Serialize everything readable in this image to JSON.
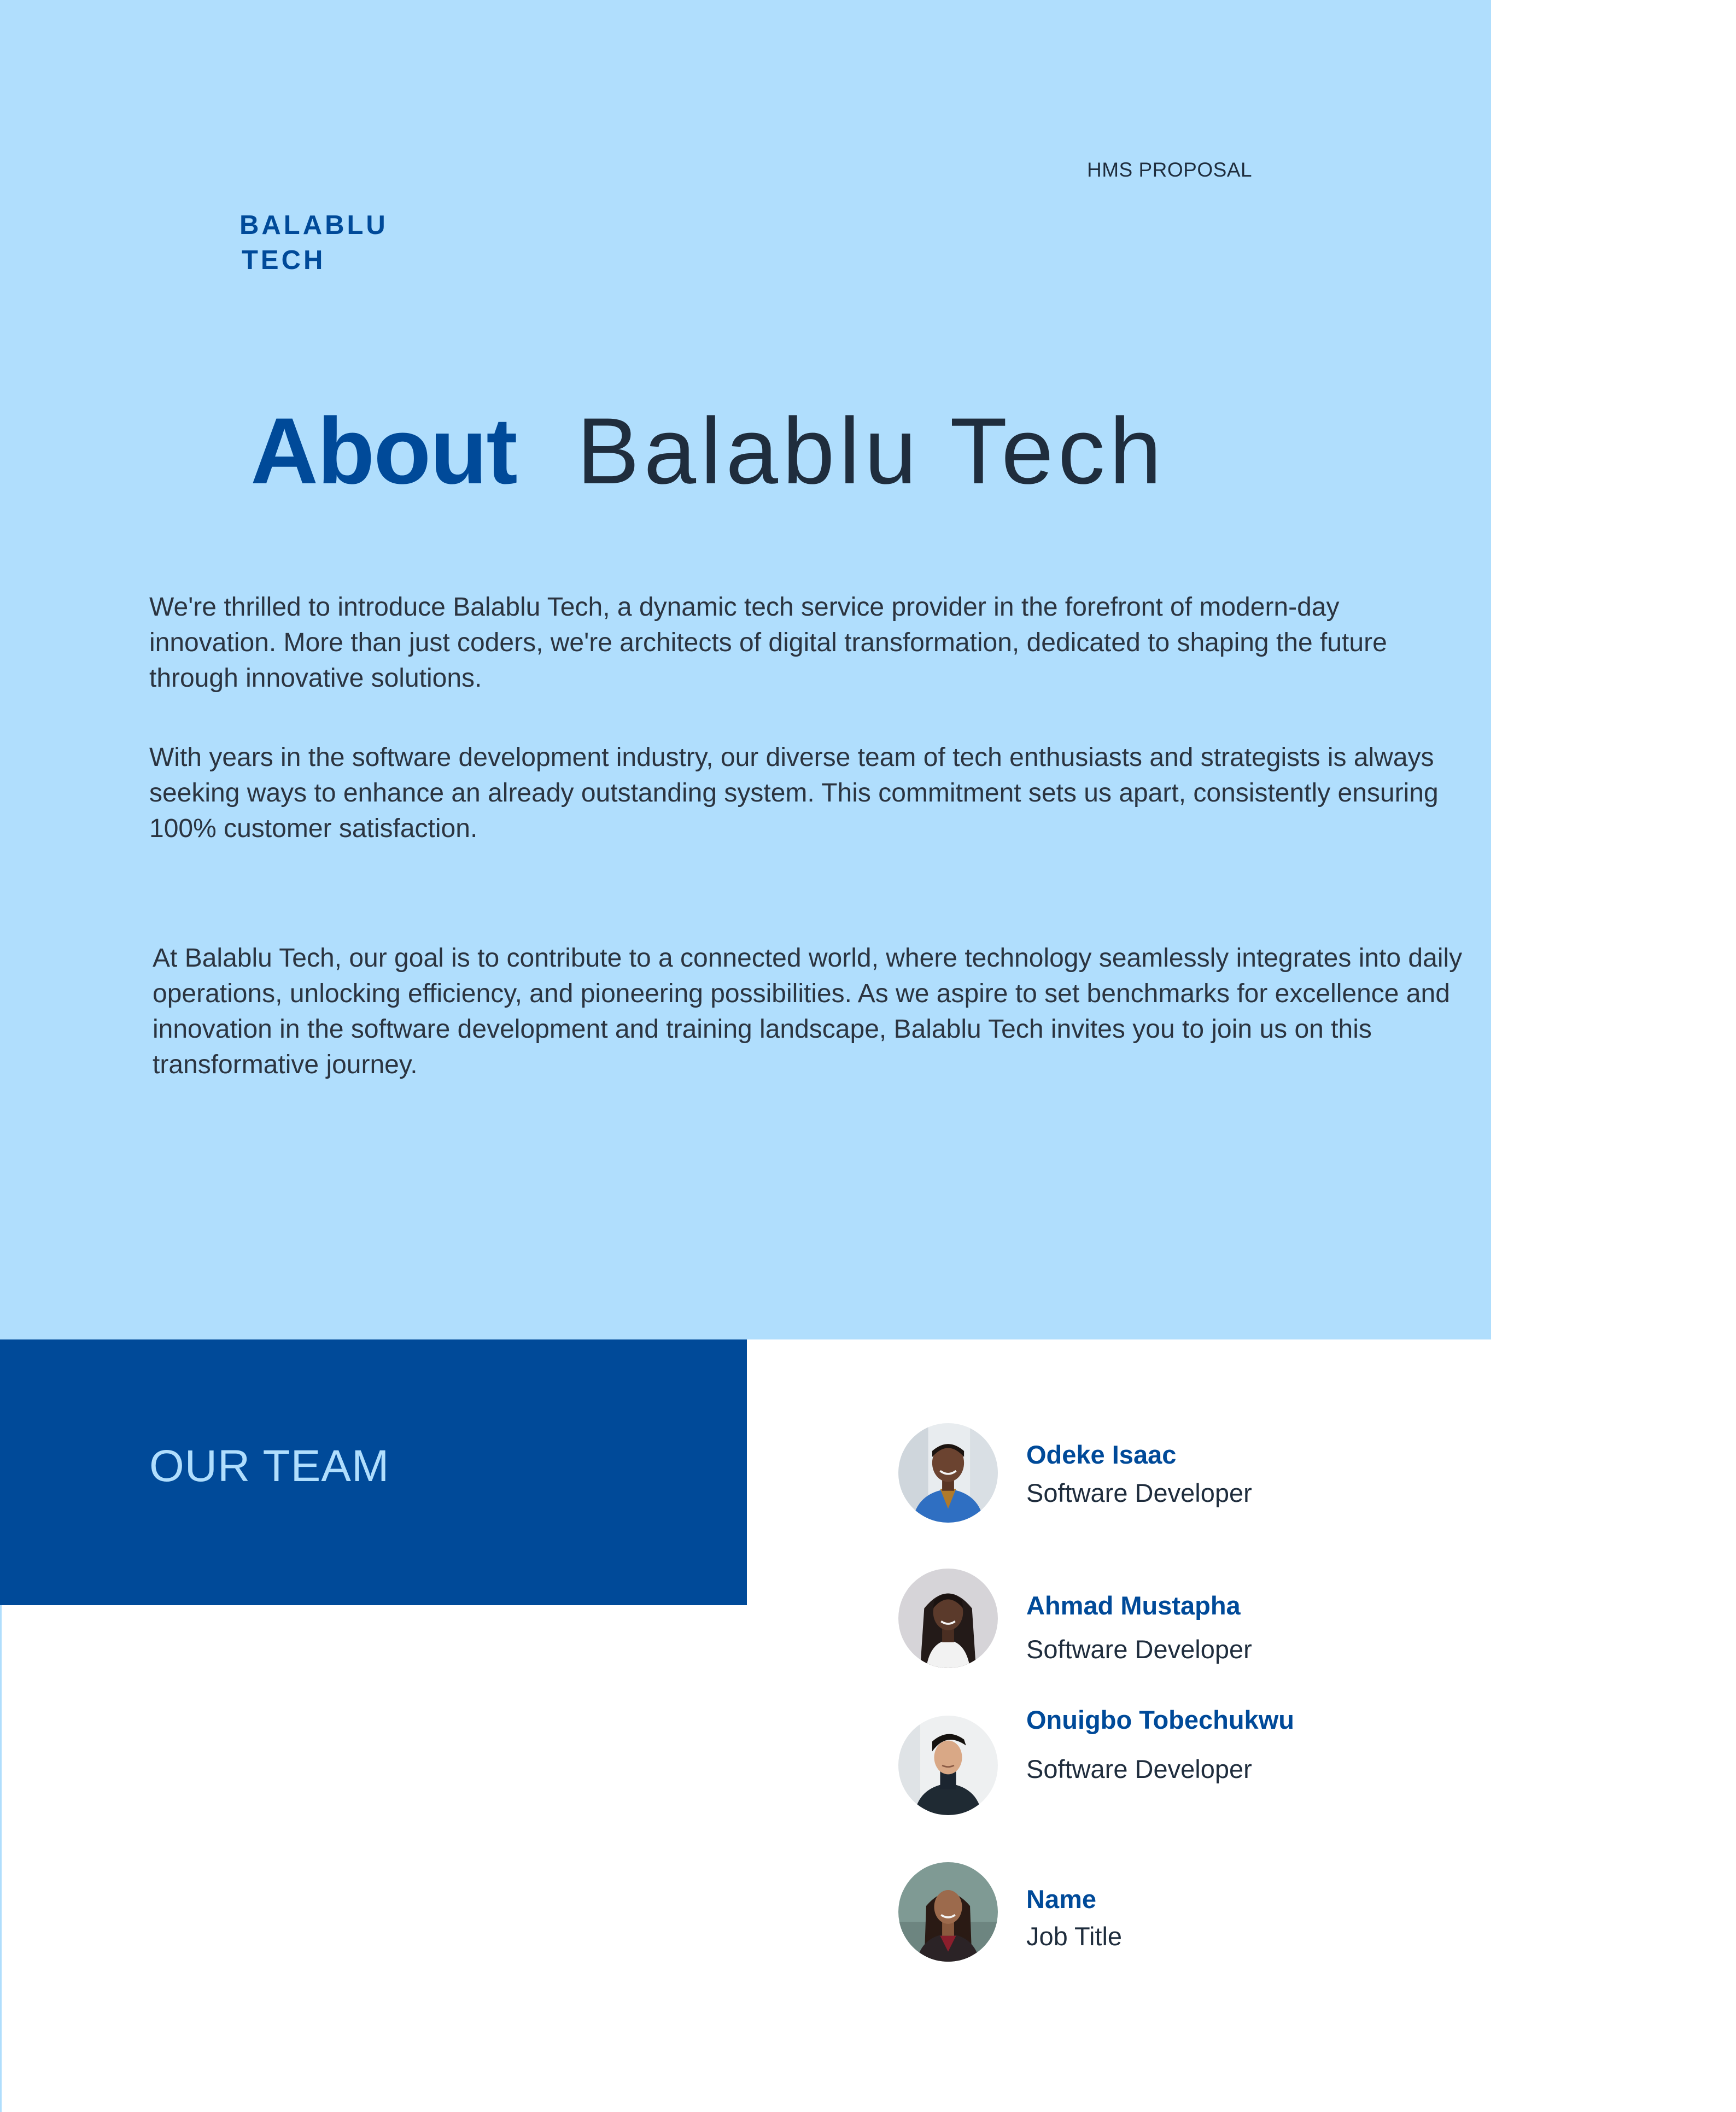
{
  "colors": {
    "hero_background": "#b0defd",
    "brand_blue": "#004a99",
    "body_text": "#2b3440",
    "dark_text": "#1f2d3d",
    "team_banner": "#004a99"
  },
  "header": {
    "proposal_tag": "HMS PROPOSAL",
    "logo_line1": "BALABLU",
    "logo_line2": "TECH"
  },
  "title": {
    "emphasis": "About",
    "rest": "Balablu Tech"
  },
  "paragraphs": [
    "We're thrilled to introduce Balablu Tech, a dynamic tech service provider in the forefront of modern-day innovation. More than just coders, we're architects of digital transformation, dedicated to shaping the future through innovative solutions.",
    "With years in the software development industry, our diverse team of tech enthusiasts and strategists is always seeking ways to enhance an already outstanding system. This commitment sets us apart, consistently ensuring 100% customer satisfaction.",
    "At Balablu Tech, our goal is to contribute to a connected world, where technology seamlessly integrates into daily operations, unlocking efficiency, and pioneering possibilities. As we aspire to set benchmarks for excellence and innovation in the software development and training landscape, Balablu Tech invites you to join us on this transformative journey."
  ],
  "team": {
    "heading": "OUR TEAM",
    "members": [
      {
        "name": "Odeke Isaac",
        "role": "Software Developer",
        "photo": "portrait-photo"
      },
      {
        "name": "Ahmad Mustapha",
        "role": "Software Developer",
        "photo": "portrait-photo"
      },
      {
        "name": "Onuigbo Tobechukwu",
        "role": "Software Developer",
        "photo": "portrait-photo"
      },
      {
        "name": "Name",
        "role": "Job Title",
        "photo": "portrait-photo"
      }
    ]
  }
}
